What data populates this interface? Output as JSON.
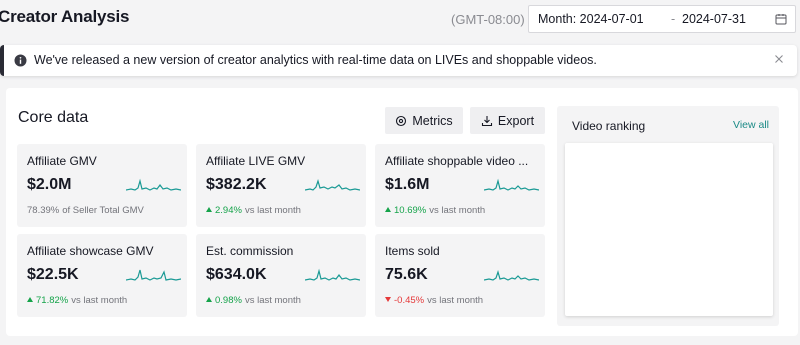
{
  "header": {
    "title": "Creator Analysis",
    "timezone": "(GMT-08:00)",
    "date_start": "Month: 2024-07-01",
    "date_separator": "-",
    "date_end": "2024-07-31"
  },
  "banner": {
    "message": "We've released a new version of creator analytics with real-time data on LIVEs and shoppable videos."
  },
  "core": {
    "title": "Core data",
    "metrics_label": "Metrics",
    "export_label": "Export",
    "cards": [
      {
        "label": "Affiliate GMV",
        "value": "$2.0M",
        "pct": "78.39%",
        "note": "of Seller Total GMV",
        "trend": "none"
      },
      {
        "label": "Affiliate LIVE GMV",
        "value": "$382.2K",
        "pct": "2.94%",
        "note": "vs last month",
        "trend": "up"
      },
      {
        "label": "Affiliate shoppable video ...",
        "value": "$1.6M",
        "pct": "10.69%",
        "note": "vs last month",
        "trend": "up"
      },
      {
        "label": "Affiliate showcase GMV",
        "value": "$22.5K",
        "pct": "71.82%",
        "note": "vs last month",
        "trend": "up"
      },
      {
        "label": "Est. commission",
        "value": "$634.0K",
        "pct": "0.98%",
        "note": "vs last month",
        "trend": "up"
      },
      {
        "label": "Items sold",
        "value": "75.6K",
        "pct": "-0.45%",
        "note": "vs last month",
        "trend": "down"
      }
    ]
  },
  "ranking": {
    "title": "Video ranking",
    "view_all": "View all"
  },
  "colors": {
    "accent": "#1a8a86",
    "up": "#15a34a",
    "down": "#e5393a"
  }
}
